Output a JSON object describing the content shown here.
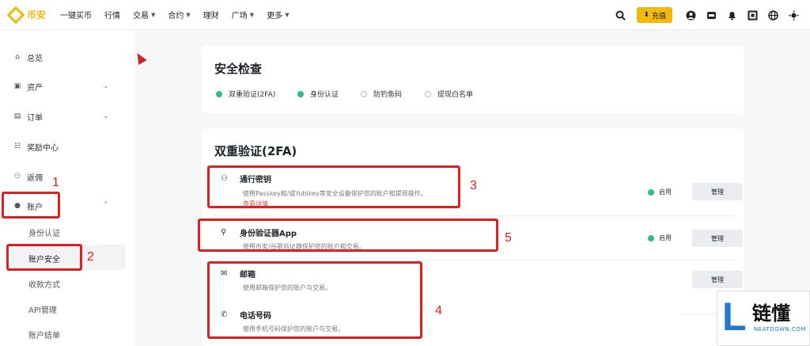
{
  "brand": {
    "name": "币安"
  },
  "nav": {
    "items": [
      {
        "label": "一键买币",
        "chevron": false
      },
      {
        "label": "行情",
        "chevron": false
      },
      {
        "label": "交易",
        "chevron": true
      },
      {
        "label": "合约",
        "chevron": true
      },
      {
        "label": "理财",
        "chevron": false
      },
      {
        "label": "广场",
        "chevron": true
      },
      {
        "label": "更多",
        "chevron": true
      }
    ],
    "deposit_label": "充值",
    "icons": [
      "search-icon",
      "deposit-icon",
      "profile-icon",
      "wallet-icon",
      "notification-icon",
      "download-icon",
      "globe-icon",
      "theme-icon"
    ]
  },
  "sidebar": {
    "items": [
      {
        "label": "总览",
        "icon": "home-icon"
      },
      {
        "label": "资产",
        "icon": "wallet-icon"
      },
      {
        "label": "订单",
        "icon": "order-icon"
      },
      {
        "label": "奖励中心",
        "icon": "reward-icon"
      },
      {
        "label": "返佣",
        "icon": "referral-icon"
      },
      {
        "label": "账户",
        "icon": "user-icon"
      }
    ],
    "sub_items": [
      "身份认证",
      "账户安全",
      "收款方式",
      "API管理",
      "账户结单"
    ]
  },
  "security_check": {
    "title": "安全检查",
    "items": [
      {
        "label": "双重验证(2FA)",
        "done": true
      },
      {
        "label": "身份认证",
        "done": true
      },
      {
        "label": "防钓鱼码",
        "done": false
      },
      {
        "label": "提现白名单",
        "done": false
      }
    ]
  },
  "twofa": {
    "title": "双重验证(2FA)",
    "rows": [
      {
        "title": "通行密钥",
        "desc": "使用Passkey和/或Yubikey等安全设备保护您的账户和提现操作。",
        "link": "查看详情",
        "status": "启用",
        "button": "管理",
        "icon": "passkey-icon"
      },
      {
        "title": "身份验证器App",
        "desc": "使用币安/谷歌验证器保护您的账户和交易。",
        "status": "启用",
        "button": "管理",
        "icon": "authenticator-icon"
      },
      {
        "title": "邮箱",
        "desc": "使用邮箱保护您的账户与交易。",
        "button": "管理",
        "icon": "mail-icon"
      },
      {
        "title": "电话号码",
        "desc": "使用手机号码保护您的账户与交易。",
        "icon": "phone-icon"
      }
    ]
  },
  "annotations": [
    "1",
    "2",
    "3",
    "4",
    "5"
  ],
  "watermark": {
    "cn": "链懂",
    "en": "NEATDOWN.COM",
    "letter": "L"
  },
  "colors": {
    "accent": "#f0b90b",
    "success": "#2ebd85",
    "annotation": "#e02020"
  }
}
